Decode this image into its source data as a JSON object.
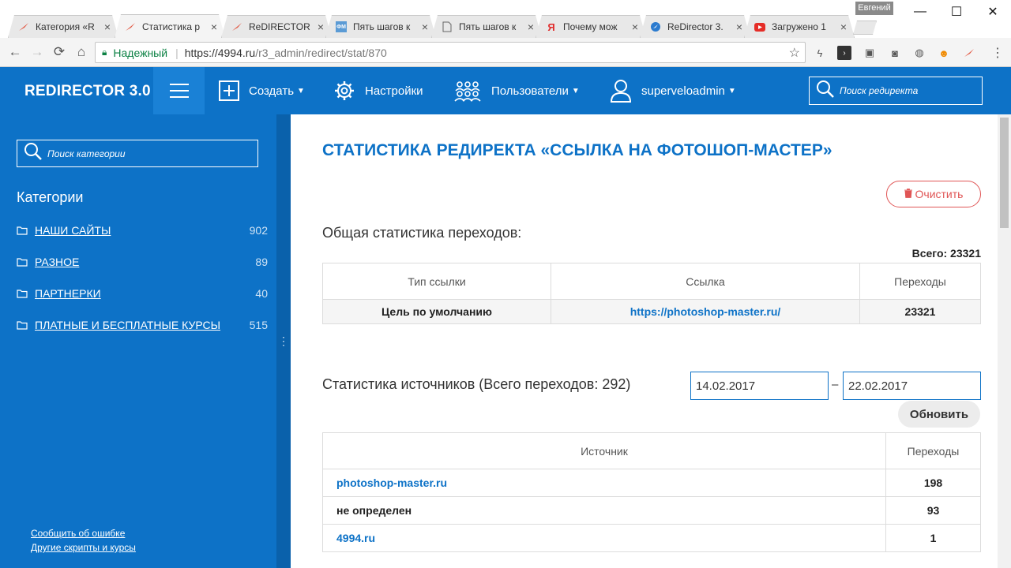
{
  "browser": {
    "tabs": [
      {
        "title": "Категория «R",
        "icon": "redirector-icon",
        "active": false
      },
      {
        "title": "Статистика р",
        "icon": "redirector-icon",
        "active": true
      },
      {
        "title": "ReDIRECTOR",
        "icon": "redirector-icon",
        "active": false
      },
      {
        "title": "Пять шагов к",
        "icon": "fm-icon",
        "active": false
      },
      {
        "title": "Пять шагов к",
        "icon": "document-icon",
        "active": false
      },
      {
        "title": "Почему мож",
        "icon": "yandex-icon",
        "active": false
      },
      {
        "title": "ReDirector 3.",
        "icon": "redirector-blue-icon",
        "active": false
      },
      {
        "title": "Загружено 1",
        "icon": "youtube-icon",
        "active": false
      }
    ],
    "profile_name": "Евгений",
    "security_label": "Надежный",
    "url_host": "https://4994.ru",
    "url_path": "/r3_admin/redirect/stat/870"
  },
  "header": {
    "brand": "REDIRECTOR 3.0",
    "create_label": "Создать",
    "settings_label": "Настройки",
    "users_label": "Пользователи",
    "account_label": "superveloadmin",
    "search_placeholder": "Поиск редиректа"
  },
  "sidebar": {
    "search_placeholder": "Поиск категории",
    "title": "Категории",
    "categories": [
      {
        "name": "НАШИ САЙТЫ",
        "count": "902"
      },
      {
        "name": "РАЗНОЕ",
        "count": "89"
      },
      {
        "name": "ПАРТНЕРКИ",
        "count": "40"
      },
      {
        "name": "ПЛАТНЫЕ И БЕСПЛАТНЫЕ КУРСЫ",
        "count": "515"
      }
    ],
    "report_link": "Сообщить об ошибке",
    "other_link": "Другие скрипты и курсы"
  },
  "main": {
    "title": "СТАТИСТИКА РЕДИРЕКТА «ССЫЛКА НА ФОТОШОП-МАСТЕР»",
    "clear_label": "Очистить",
    "overall_title": "Общая статистика переходов:",
    "overall_total": "Всего: 23321",
    "overall_table": {
      "headers": [
        "Тип ссылки",
        "Ссылка",
        "Переходы"
      ],
      "rows": [
        [
          "Цель по умолчанию",
          "https://photoshop-master.ru/",
          "23321"
        ]
      ]
    },
    "sources_title": "Статистика источников (Всего переходов: 292)",
    "date_from": "14.02.2017",
    "date_sep": "–",
    "date_to": "22.02.2017",
    "refresh_label": "Обновить",
    "sources_table": {
      "headers": [
        "Источник",
        "Переходы"
      ],
      "rows": [
        {
          "source": "photoshop-master.ru",
          "count": "198",
          "link": true
        },
        {
          "source": "не определен",
          "count": "93",
          "link": false
        },
        {
          "source": "4994.ru",
          "count": "1",
          "link": true
        }
      ]
    }
  },
  "colors": {
    "brand_blue": "#0d72c7",
    "danger_red": "#e05555"
  }
}
